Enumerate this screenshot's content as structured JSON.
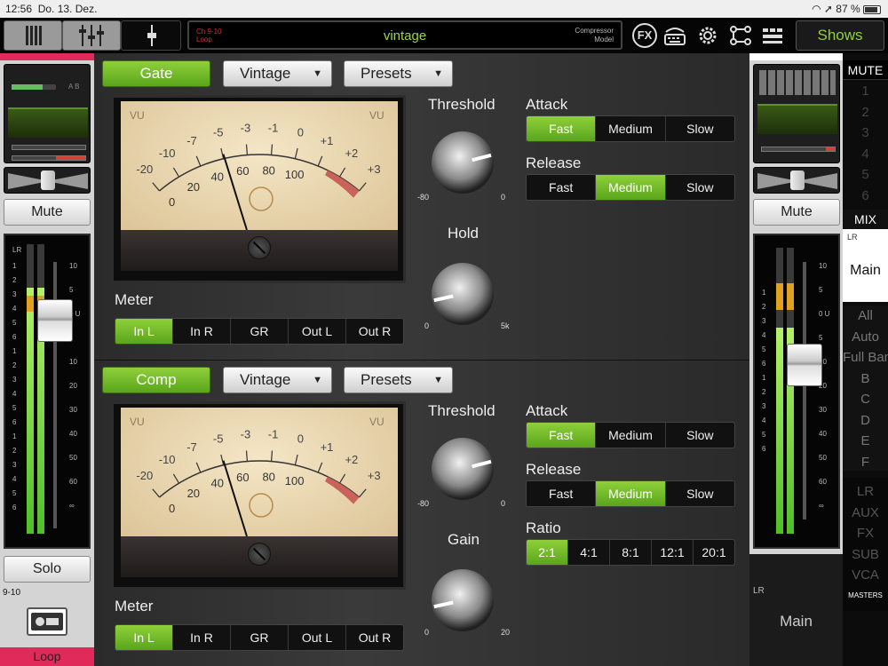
{
  "status": {
    "time": "12:56",
    "date": "Do. 13. Dez.",
    "battery": "87 %"
  },
  "lcd": {
    "channel_line1": "Ch 9-10",
    "channel_line2": "Loop",
    "name": "vintage",
    "mode_line1": "Compressor",
    "mode_line2": "Model"
  },
  "toolbar": {
    "fx_label": "FX",
    "shows_label": "Shows"
  },
  "icons": [
    "faders-icon",
    "eq-icon",
    "single-fader-icon",
    "fx-icon",
    "keyboard-icon",
    "gear-icon",
    "routing-icon",
    "grid-icon"
  ],
  "left_strip": {
    "mute_label": "Mute",
    "solo_label": "Solo",
    "channel_number": "9-10",
    "channel_name": "Loop",
    "meter_label": "LR",
    "ab_label": "A B",
    "scale_left": [
      "1",
      "2",
      "3",
      "4",
      "5",
      "6",
      "1",
      "2",
      "3",
      "4",
      "5",
      "6",
      "1",
      "2",
      "3",
      "4",
      "5",
      "6"
    ],
    "scale_right": [
      "10",
      "5",
      "0 U",
      "5",
      "10",
      "20",
      "30",
      "40",
      "50",
      "60",
      "∞"
    ],
    "meter_level": 0.85,
    "fader_level": 0.78
  },
  "gate": {
    "enable_label": "Gate",
    "model_label": "Vintage",
    "presets_label": "Presets",
    "vu_top_labels": [
      "-20",
      "-10",
      "-7",
      "-5",
      "-3",
      "-1",
      "0",
      "+1",
      "+2",
      "+3"
    ],
    "vu_bottom_labels": [
      "0",
      "20",
      "40",
      "60",
      "80",
      "100"
    ],
    "vu_left": "VU",
    "vu_right": "VU",
    "meter_label": "Meter",
    "meter_options": [
      "In L",
      "In R",
      "GR",
      "Out L",
      "Out R"
    ],
    "meter_selected": "In L",
    "threshold_label": "Threshold",
    "threshold_min": "-80",
    "threshold_max": "0",
    "threshold_value": 0.78,
    "hold_label": "Hold",
    "hold_min": "0",
    "hold_max": "5k",
    "hold_value": 0.12,
    "attack_label": "Attack",
    "attack_options": [
      "Fast",
      "Medium",
      "Slow"
    ],
    "attack_selected": "Fast",
    "release_label": "Release",
    "release_options": [
      "Fast",
      "Medium",
      "Slow"
    ],
    "release_selected": "Medium"
  },
  "comp": {
    "enable_label": "Comp",
    "model_label": "Vintage",
    "presets_label": "Presets",
    "vu_top_labels": [
      "-20",
      "-10",
      "-7",
      "-5",
      "-3",
      "-1",
      "0",
      "+1",
      "+2",
      "+3"
    ],
    "vu_bottom_labels": [
      "0",
      "20",
      "40",
      "60",
      "80",
      "100"
    ],
    "vu_left": "VU",
    "vu_right": "VU",
    "meter_label": "Meter",
    "meter_options": [
      "In L",
      "In R",
      "GR",
      "Out L",
      "Out R"
    ],
    "meter_selected": "In L",
    "threshold_label": "Threshold",
    "threshold_min": "-80",
    "threshold_max": "0",
    "threshold_value": 0.78,
    "gain_label": "Gain",
    "gain_min": "0",
    "gain_max": "20",
    "gain_value": 0.12,
    "attack_label": "Attack",
    "attack_options": [
      "Fast",
      "Medium",
      "Slow"
    ],
    "attack_selected": "Fast",
    "release_label": "Release",
    "release_options": [
      "Fast",
      "Medium",
      "Slow"
    ],
    "release_selected": "Medium",
    "ratio_label": "Ratio",
    "ratio_options": [
      "2:1",
      "4:1",
      "8:1",
      "12:1",
      "20:1"
    ],
    "ratio_selected": "2:1"
  },
  "right_strip": {
    "mute_label": "Mute",
    "meter_label": "LR",
    "bus_label": "LR",
    "bus_name": "Main",
    "meter_level": 0.72,
    "fader_level": 0.6,
    "scale_left": [
      "1",
      "2",
      "3",
      "4",
      "5",
      "6",
      "1",
      "2",
      "3",
      "4",
      "5",
      "6"
    ],
    "scale_right": [
      "10",
      "5",
      "0 U",
      "5",
      "10",
      "20",
      "30",
      "40",
      "50",
      "60",
      "∞"
    ]
  },
  "right_col": {
    "mute_header": "MUTE",
    "mute_groups": [
      "1",
      "2",
      "3",
      "4",
      "5",
      "6"
    ],
    "mix_header": "MIX",
    "mix_label": "LR",
    "mix_name": "Main",
    "filters": [
      "All",
      "Auto",
      "Full Band",
      "B",
      "C",
      "D",
      "E",
      "F"
    ],
    "filter_selected": "All",
    "masters": [
      "LR",
      "AUX",
      "FX",
      "SUB",
      "VCA"
    ],
    "masters_label": "MASTERS"
  },
  "colors": {
    "accent_green": "#7cc42c",
    "lcd_text": "#9bd44a",
    "pink_bar": "#e02a5a",
    "vu_red": "#c9625a"
  }
}
